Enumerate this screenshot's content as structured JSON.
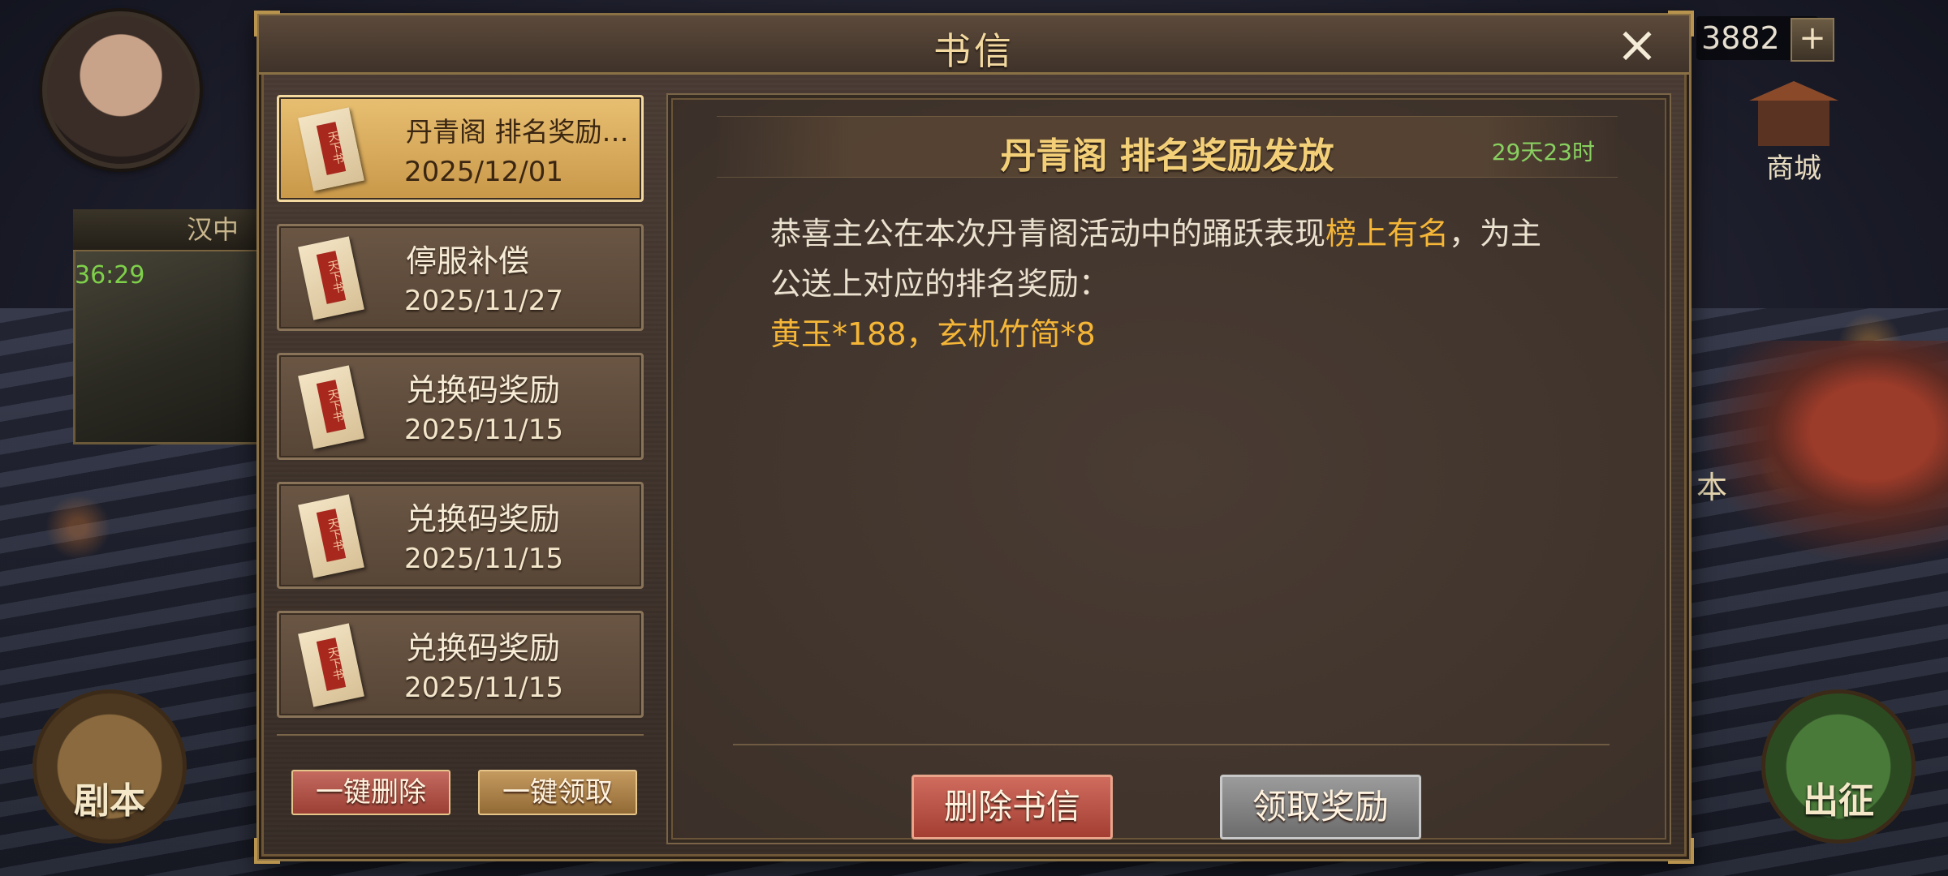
{
  "background": {
    "minimap_label": "汉中",
    "minimap_timer": "36:29",
    "shop_label": "商城",
    "currency_value": "3882",
    "currency_add": "+",
    "right_hero_text": "本",
    "script_button": "剧本",
    "go_button": "出征"
  },
  "dialog": {
    "title": "书信",
    "close_icon": "×"
  },
  "mail_list": [
    {
      "title": "丹青阁 排名奖励发放",
      "date": "2025/12/01",
      "selected": true
    },
    {
      "title": "停服补偿",
      "date": "2025/11/27",
      "selected": false
    },
    {
      "title": "兑换码奖励",
      "date": "2025/11/15",
      "selected": false
    },
    {
      "title": "兑换码奖励",
      "date": "2025/11/15",
      "selected": false
    },
    {
      "title": "兑换码奖励",
      "date": "2025/11/15",
      "selected": false
    }
  ],
  "list_buttons": {
    "delete_all": "一键删除",
    "claim_all": "一键领取"
  },
  "mail_detail": {
    "subject": "丹青阁 排名奖励发放",
    "expire": "29天23时",
    "body_before": "恭喜主公在本次丹青阁活动中的踊跃表现",
    "body_highlight": "榜上有名",
    "body_after": "，为主公送上对应的排名奖励：",
    "rewards": "黄玉*188，玄机竹简*8",
    "delete_button": "删除书信",
    "claim_button": "领取奖励"
  },
  "colors": {
    "highlight": "#f5b637",
    "expire_green": "#88d060",
    "title_gold": "#f3d9a0"
  }
}
